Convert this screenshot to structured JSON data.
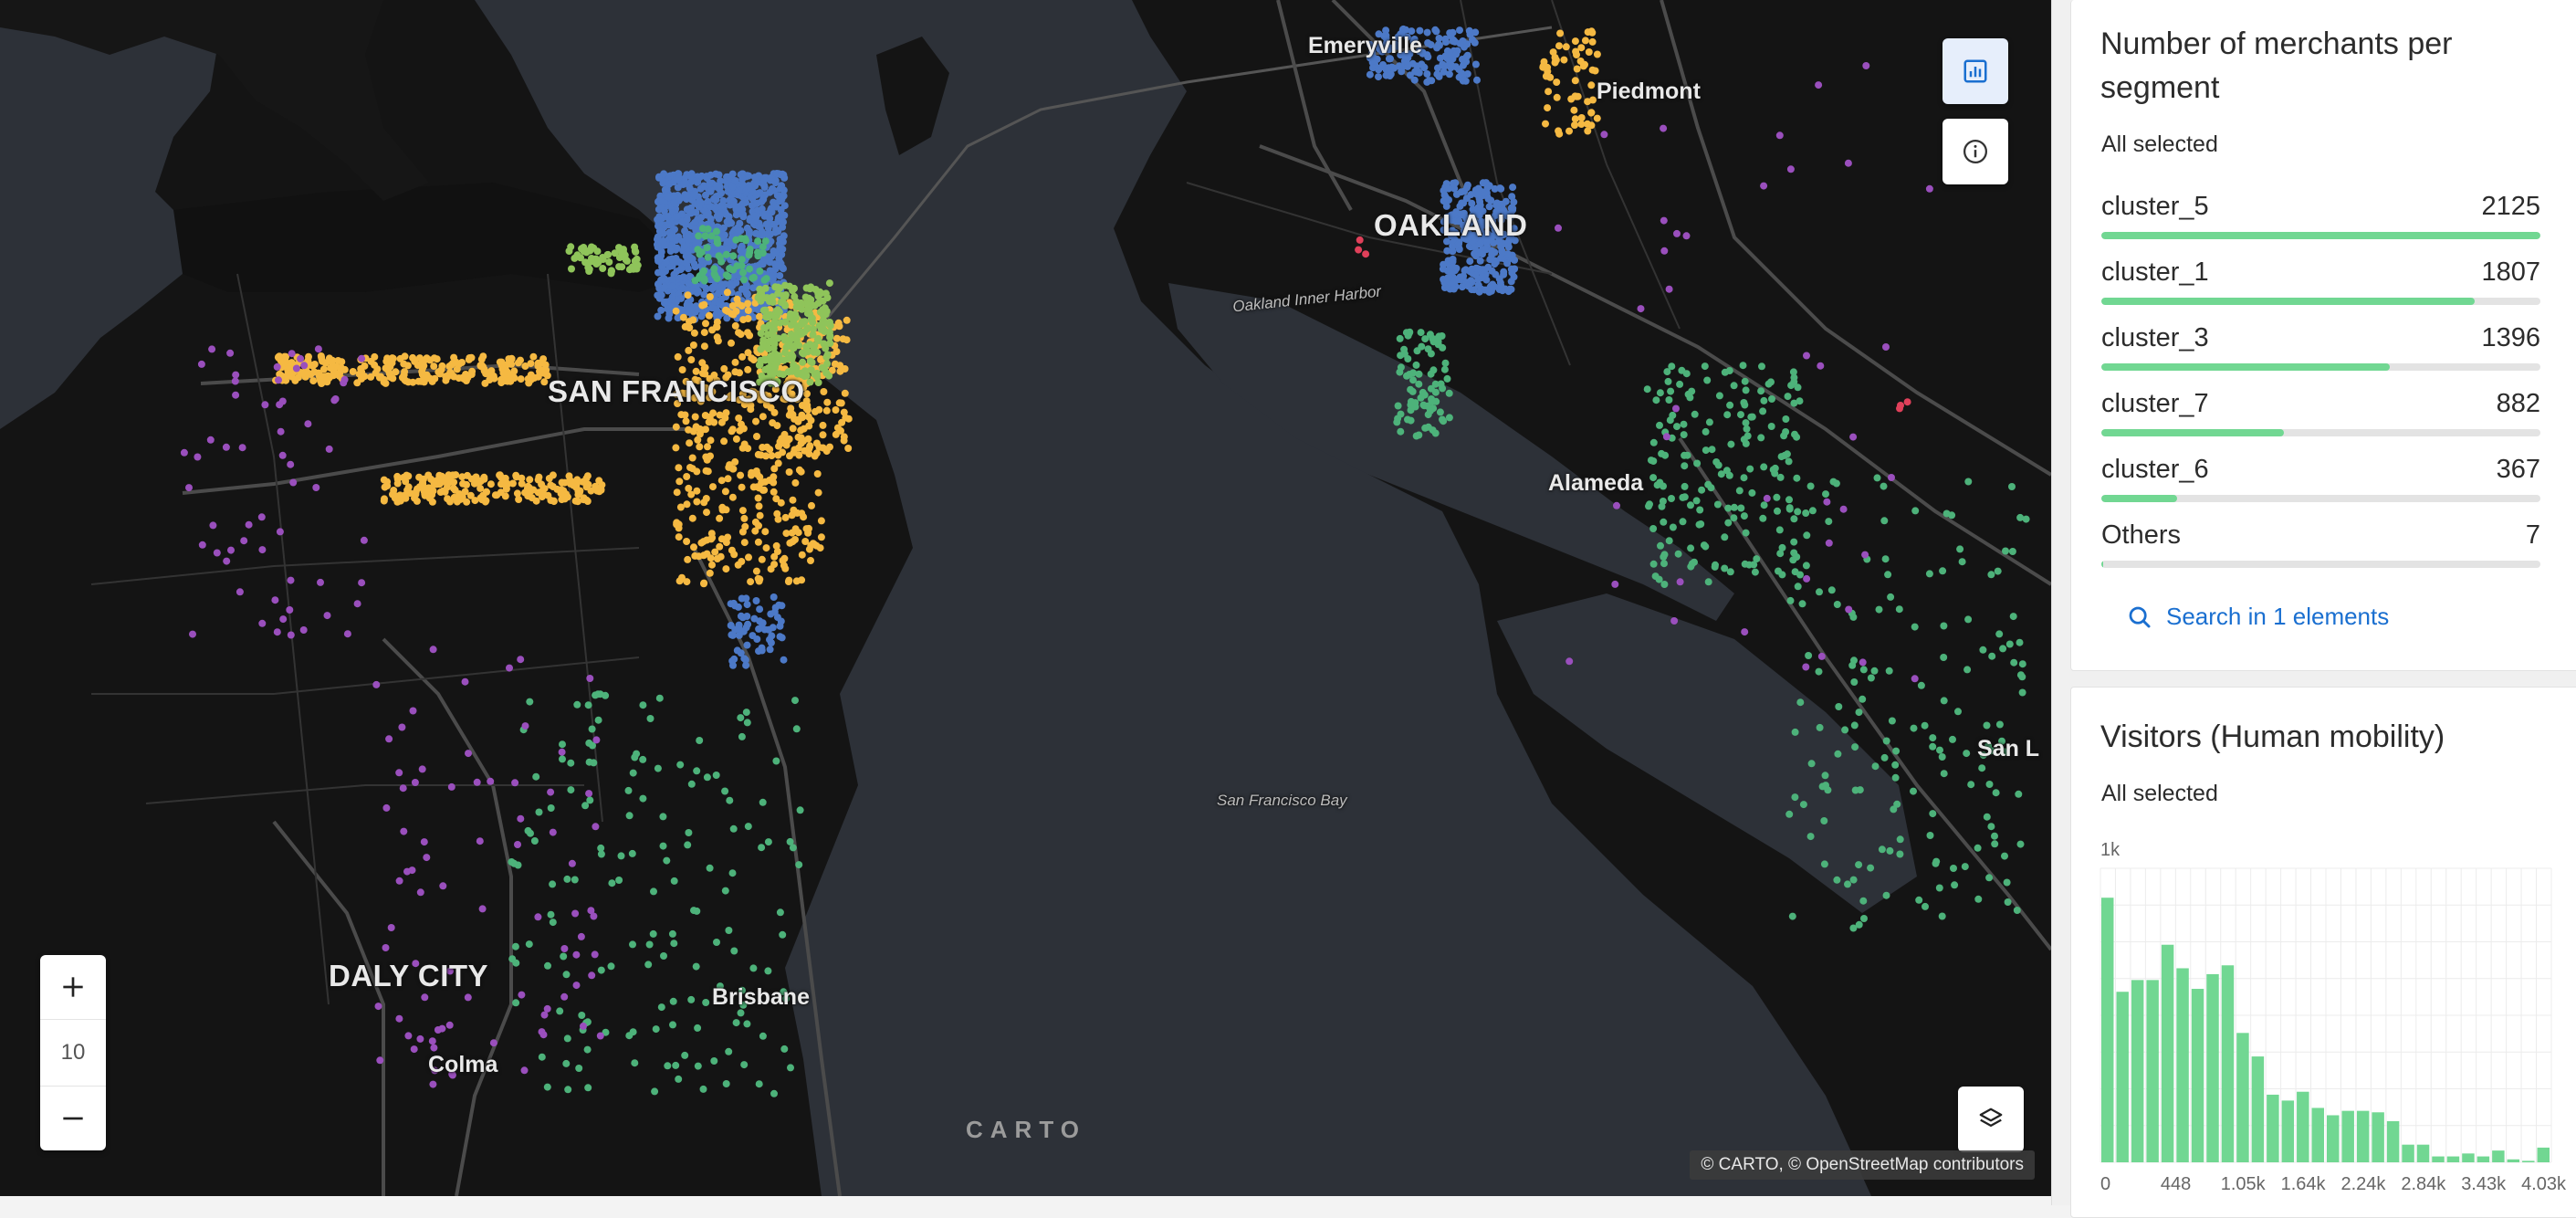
{
  "map": {
    "places": [
      {
        "name": "Emeryville",
        "cls": "med"
      },
      {
        "name": "Piedmont",
        "cls": "med"
      },
      {
        "name": "OAKLAND",
        "cls": "big"
      },
      {
        "name": "Oakland Inner Harbor",
        "cls": "water"
      },
      {
        "name": "SAN FRANCISCO",
        "cls": "big"
      },
      {
        "name": "Alameda",
        "cls": "med"
      },
      {
        "name": "San Francisco Bay",
        "cls": "water"
      },
      {
        "name": "San L",
        "cls": "med"
      },
      {
        "name": "DALY CITY",
        "cls": "big"
      },
      {
        "name": "Brisbane",
        "cls": "med"
      },
      {
        "name": "Colma",
        "cls": "med"
      }
    ],
    "zoom_level": "10",
    "zoom_in_label": "+",
    "zoom_out_label": "−",
    "logo_text": "CARTO",
    "attribution": "© CARTO, © OpenStreetMap contributors",
    "colors": {
      "land": "#141414",
      "water": "#2d3138",
      "roads": "#4a4a4a",
      "cluster_5": "#4c79c7",
      "cluster_1": "#f5b942",
      "cluster_3": "#4db27a",
      "cluster_7": "#9a4fbd",
      "cluster_6": "#8fc45a",
      "others": "#e0405a"
    },
    "icons": {
      "widgets_toggle": "bar-chart-icon",
      "info": "info-icon",
      "layers": "layers-icon"
    }
  },
  "widgets": {
    "segments": {
      "title": "Number of merchants per segment",
      "selection": "All selected",
      "max": 2125,
      "rows": [
        {
          "label": "cluster_5",
          "value": 2125
        },
        {
          "label": "cluster_1",
          "value": 1807
        },
        {
          "label": "cluster_3",
          "value": 1396
        },
        {
          "label": "cluster_7",
          "value": 882
        },
        {
          "label": "cluster_6",
          "value": 367
        },
        {
          "label": "Others",
          "value": 7
        }
      ],
      "search_label": "Search in 1 elements",
      "bar_color": "#71d792"
    },
    "visitors": {
      "title": "Visitors (Human mobility)",
      "selection": "All selected"
    }
  },
  "chart_data": {
    "type": "bar",
    "title": "Visitors (Human mobility)",
    "ylabel_tick": "1k",
    "ylim": [
      0,
      1000
    ],
    "x_tick_labels": [
      "0",
      "448",
      "1.05k",
      "1.64k",
      "2.24k",
      "2.84k",
      "3.43k",
      "4.03k"
    ],
    "values": [
      900,
      580,
      620,
      620,
      740,
      660,
      590,
      640,
      670,
      440,
      360,
      230,
      210,
      240,
      185,
      160,
      175,
      175,
      170,
      140,
      60,
      60,
      20,
      20,
      30,
      20,
      40,
      10,
      5,
      50
    ],
    "grid": true,
    "color": "#71d792"
  }
}
